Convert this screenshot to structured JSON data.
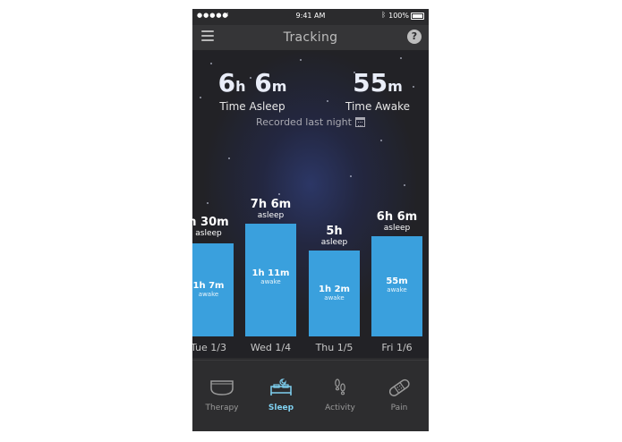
{
  "status_bar": {
    "carrier": "●●●●●",
    "time": "9:41 AM",
    "battery": "100%"
  },
  "header": {
    "title": "Tracking"
  },
  "summary": {
    "asleep_hours": "6",
    "asleep_hours_unit": "h",
    "asleep_minutes": "6",
    "asleep_minutes_unit": "m",
    "asleep_label": "Time Asleep",
    "awake_minutes": "55",
    "awake_minutes_unit": "m",
    "awake_label": "Time Awake",
    "recorded": "Recorded last night"
  },
  "days": [
    {
      "day": "Tue 1/3",
      "asleep": "h 30m",
      "asleep_label": "asleep",
      "awake": "1h 7m",
      "awake_label": "awake"
    },
    {
      "day": "Wed 1/4",
      "asleep": "7h 6m",
      "asleep_label": "asleep",
      "awake": "1h 11m",
      "awake_label": "awake"
    },
    {
      "day": "Thu 1/5",
      "asleep": "5h",
      "asleep_label": "asleep",
      "awake": "1h 2m",
      "awake_label": "awake"
    },
    {
      "day": "Fri 1/6",
      "asleep": "6h 6m",
      "asleep_label": "asleep",
      "awake": "55m",
      "awake_label": "awake"
    }
  ],
  "tabs": [
    {
      "label": "Therapy",
      "icon": "therapy-device-icon"
    },
    {
      "label": "Sleep",
      "icon": "bed-icon"
    },
    {
      "label": "Activity",
      "icon": "footsteps-icon"
    },
    {
      "label": "Pain",
      "icon": "bandage-icon"
    }
  ],
  "colors": {
    "bar": "#3aa0dd",
    "active_tab": "#7fd0f0"
  }
}
